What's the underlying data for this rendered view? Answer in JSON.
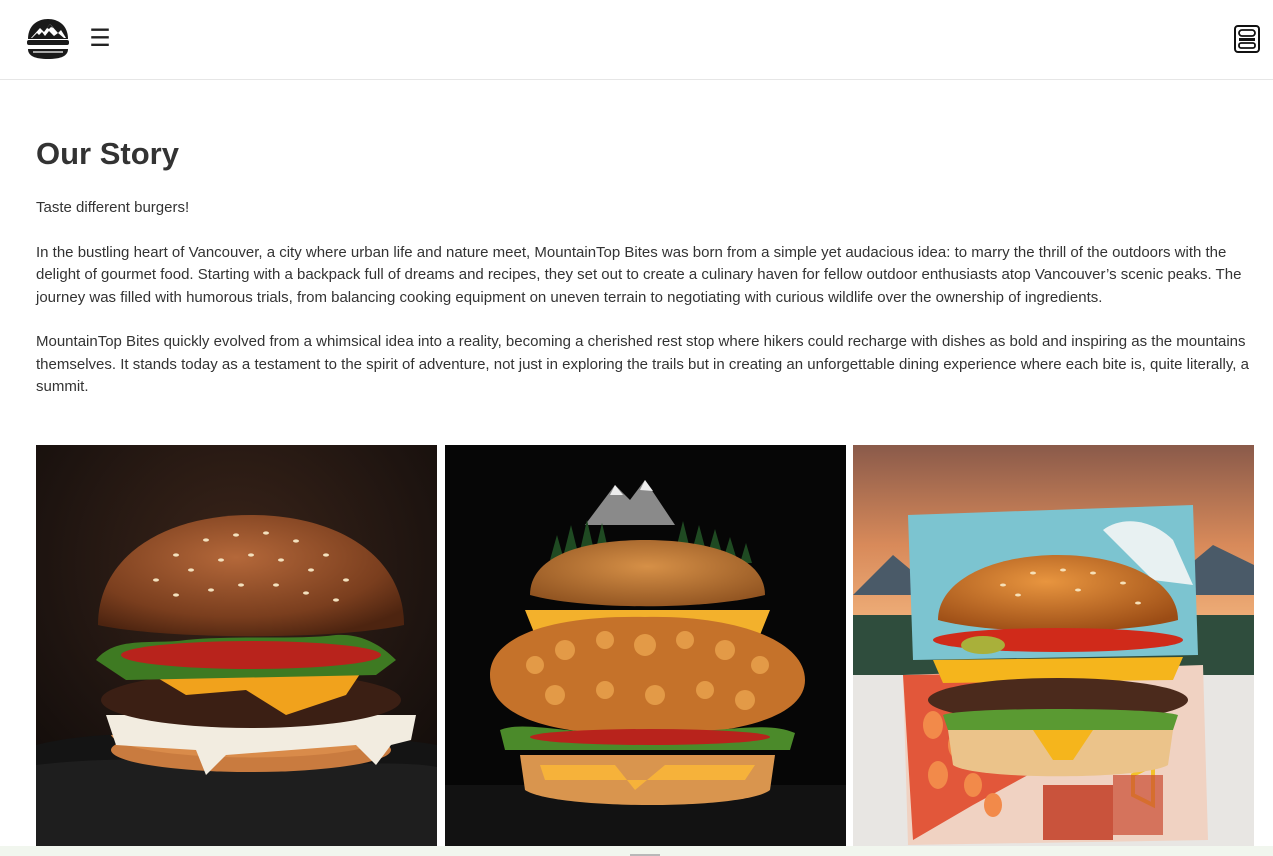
{
  "header": {
    "logo_icon": "burger-mountain-logo-icon",
    "menu_icon": "☰",
    "cart_icon": "takeout-box-icon"
  },
  "story": {
    "title": "Our Story",
    "tagline": "Taste different burgers!",
    "paragraphs": [
      "In the bustling heart of Vancouver, a city where urban life and nature meet, MountainTop Bites was born from a simple yet audacious idea: to marry the thrill of the outdoors with the delight of gourmet food. Starting with a backpack full of dreams and recipes, they set out to create a culinary haven for fellow outdoor enthusiasts atop Vancouver’s scenic peaks. The journey was filled with humorous trials, from balancing cooking equipment on uneven terrain to negotiating with curious wildlife over the ownership of ingredients.",
      "MountainTop Bites quickly evolved from a whimsical idea into a reality, becoming a cherished rest stop where hikers could recharge with dishes as bold and inspiring as the mountains themselves. It stands today as a testament to the spirit of adventure, not just in exploring the trails but in creating an unforgettable dining experience where each bite is, quite literally, a summit."
    ]
  },
  "gallery": [
    {
      "name": "cheeseburger-on-rock-photo"
    },
    {
      "name": "crispy-chicken-burger-with-mountain-top-photo"
    },
    {
      "name": "burger-in-takeout-box-photo"
    }
  ],
  "colors": {
    "text": "#333333",
    "header_border": "#e6e6e6",
    "bottom_bar": "#f1f6ee"
  }
}
